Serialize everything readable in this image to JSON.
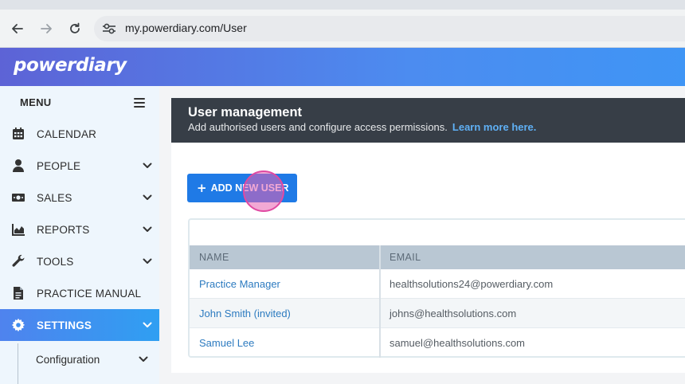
{
  "browser": {
    "url": "my.powerdiary.com/User",
    "back_icon": "arrow-left-icon",
    "forward_icon": "arrow-right-icon",
    "reload_icon": "reload-icon",
    "site_info_icon": "tune-icon"
  },
  "app": {
    "logo_text": "powerdiary"
  },
  "sidebar": {
    "menu_label": "MENU",
    "items": [
      {
        "label": "CALENDAR",
        "icon": "calendar-icon"
      },
      {
        "label": "PEOPLE",
        "icon": "person-icon"
      },
      {
        "label": "SALES",
        "icon": "money-icon"
      },
      {
        "label": "REPORTS",
        "icon": "chart-icon"
      },
      {
        "label": "TOOLS",
        "icon": "wrench-icon"
      },
      {
        "label": "PRACTICE MANUAL",
        "icon": "document-icon"
      },
      {
        "label": "SETTINGS",
        "icon": "gear-icon"
      }
    ],
    "sub_items": [
      {
        "label": "Configuration"
      }
    ]
  },
  "main": {
    "title": "User management",
    "subtitle": "Add authorised users and configure access permissions.",
    "learn_more": "Learn more here.",
    "add_button": "ADD NEW USER",
    "table": {
      "headers": [
        "NAME",
        "EMAIL"
      ],
      "rows": [
        {
          "name": "Practice Manager",
          "email": "healthsolutions24@powerdiary.com"
        },
        {
          "name": "John Smith (invited)",
          "email": "johns@healthsolutions.com"
        },
        {
          "name": "Samuel Lee",
          "email": "samuel@healthsolutions.com"
        }
      ]
    }
  },
  "colors": {
    "accent": "#1f7ae6",
    "header_dark": "#373e47",
    "link": "#2d7bc0"
  }
}
